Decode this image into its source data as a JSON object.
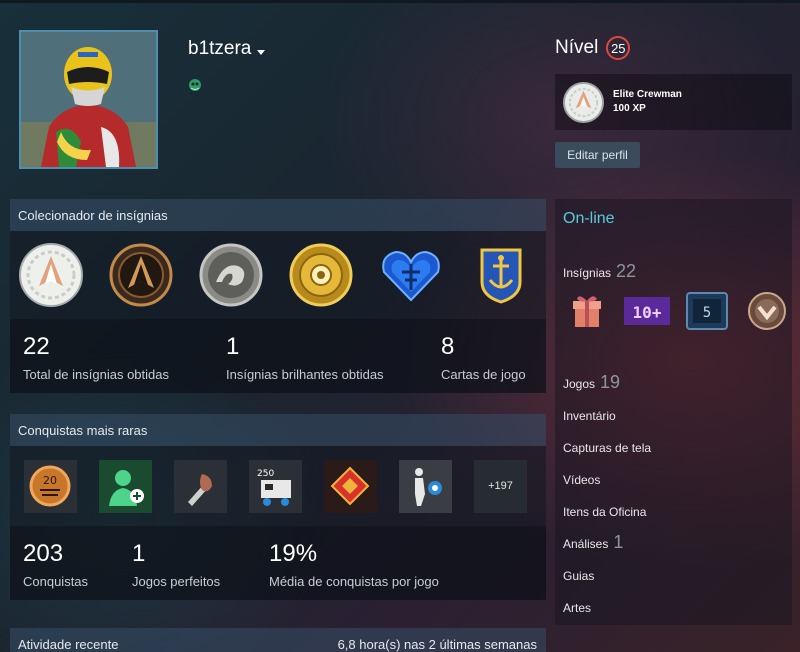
{
  "profile": {
    "persona_name": "b1tzera",
    "level_label": "Nível",
    "level": "25",
    "favorite_badge": {
      "name": "Elite Crewman",
      "xp": "100 XP"
    },
    "edit_button": "Editar perfil"
  },
  "badge_collector": {
    "title": "Colecionador de insígnias",
    "badges": [
      "elite-crewman-badge-icon",
      "bronze-emblem-badge-icon",
      "dragon-coin-badge-icon",
      "gold-coin-badge-icon",
      "blue-heart-badge-icon",
      "anchor-shield-badge-icon"
    ],
    "stats": [
      {
        "value": "22",
        "label": "Total de insígnias obtidas"
      },
      {
        "value": "1",
        "label": "Insígnias brilhantes obtidas"
      },
      {
        "value": "8",
        "label": "Cartas de jogo"
      }
    ]
  },
  "achievements": {
    "title": "Conquistas mais raras",
    "more_label": "+197",
    "stats": [
      {
        "value": "203",
        "label": "Conquistas"
      },
      {
        "value": "1",
        "label": "Jogos perfeitos"
      },
      {
        "value": "19%",
        "label": "Média de conquistas por jogo"
      }
    ]
  },
  "recent_activity": {
    "title": "Atividade recente",
    "summary": "6,8 hora(s) nas 2 últimas semanas"
  },
  "sidebar": {
    "status": "On-line",
    "badges_label": "Insígnias",
    "badges_count": "22",
    "side_badges": [
      "gift-box-badge-icon",
      "ten-plus-badge-icon",
      "five-years-badge-icon",
      "chevron-medal-badge-icon"
    ],
    "five_label": "5",
    "ten_label": "10+",
    "games_label": "Jogos",
    "games_count": "19",
    "inventory_label": "Inventário",
    "screenshots_label": "Capturas de tela",
    "videos_label": "Vídeos",
    "workshop_label": "Itens da Oficina",
    "reviews_label": "Análises",
    "reviews_count": "1",
    "guides_label": "Guias",
    "artwork_label": "Artes"
  }
}
